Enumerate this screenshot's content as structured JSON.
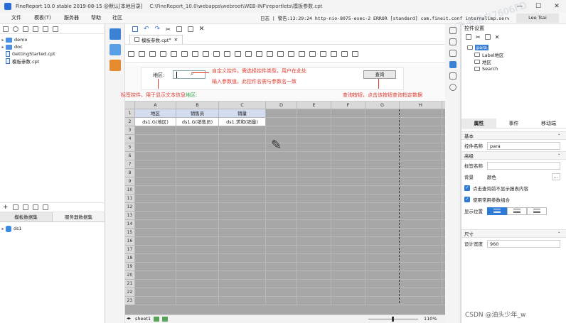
{
  "titlebar": {
    "title": "FineReport 10.0 stable 2019-08-15 @默认[本地目录]",
    "path": "C:\\FineReport_10.0\\webapps\\webroot\\WEB-INF\\reportlets\\模板参数.cpt",
    "min": "—",
    "max": "☐",
    "close": "✕"
  },
  "menu": {
    "file": "文件",
    "template": "模板(T)",
    "server": "服务器",
    "help": "帮助",
    "community": "社区",
    "log": "日志 | 警告:13:29:24 http-nio-8075-exec-2 ERROR [standard] com.fineit.conf internalimp.service.st..",
    "user": "Lee Tsai"
  },
  "left": {
    "tree": [
      {
        "label": "demo",
        "type": "folder"
      },
      {
        "label": "doc",
        "type": "folder"
      },
      {
        "label": "GettingStarted.cpt",
        "type": "file"
      },
      {
        "label": "模板参数.cpt",
        "type": "file"
      }
    ],
    "ds_tabs": [
      "模板数据集",
      "服务器数据集"
    ],
    "datasets": [
      "ds1"
    ]
  },
  "tab": {
    "label": "模板参数.cpt",
    "modified": "*"
  },
  "param": {
    "label_text": "地区:",
    "query_button": "查询",
    "annotations": {
      "top_right": "自定义控件，需选择控件类型，用户在此处",
      "top_right2": "输入参数值，此控件名需与参数名一致",
      "bottom_left_a": "标签控件，用于显示文本信息",
      "bottom_left_b": "地区:",
      "bottom_right": "查询按钮，点击该按钮查询指定数据"
    }
  },
  "sheet": {
    "columns": [
      "A",
      "B",
      "C",
      "D",
      "E",
      "F",
      "G",
      "H",
      "I"
    ],
    "rows": [
      "1",
      "2",
      "3",
      "4",
      "5",
      "6",
      "7",
      "8",
      "9",
      "10",
      "11",
      "12",
      "13",
      "14",
      "15",
      "16",
      "17",
      "18",
      "19",
      "20",
      "21",
      "22",
      "23"
    ],
    "header_cells": [
      "地区",
      "销售员",
      "销量"
    ],
    "data_cells": [
      "ds1.G(地区)",
      "ds1.G(销售员)",
      "ds1.求和(销量)"
    ],
    "sheet_tab": "sheet1",
    "zoom": "110%"
  },
  "right": {
    "title": "控件设置",
    "tree": [
      "para",
      "Label地区",
      "地区",
      "Search"
    ],
    "tabs": [
      "属性",
      "事件",
      "移动端"
    ],
    "section_basic": "基本",
    "control_name_label": "控件名称",
    "control_name_value": "para",
    "section_advanced": "高级",
    "tag_name_label": "标签名称",
    "background_label": "背景",
    "background_value": "颜色",
    "chk1": "点击查询前不显示报表内容",
    "chk2": "使用常用参数组合",
    "display_pos_label": "显示位置",
    "section_size": "尺寸",
    "design_width_label": "设计宽度",
    "design_width_value": "960"
  },
  "watermark": "飞书用户7606FD",
  "csdn": "CSDN @油头少年_w"
}
